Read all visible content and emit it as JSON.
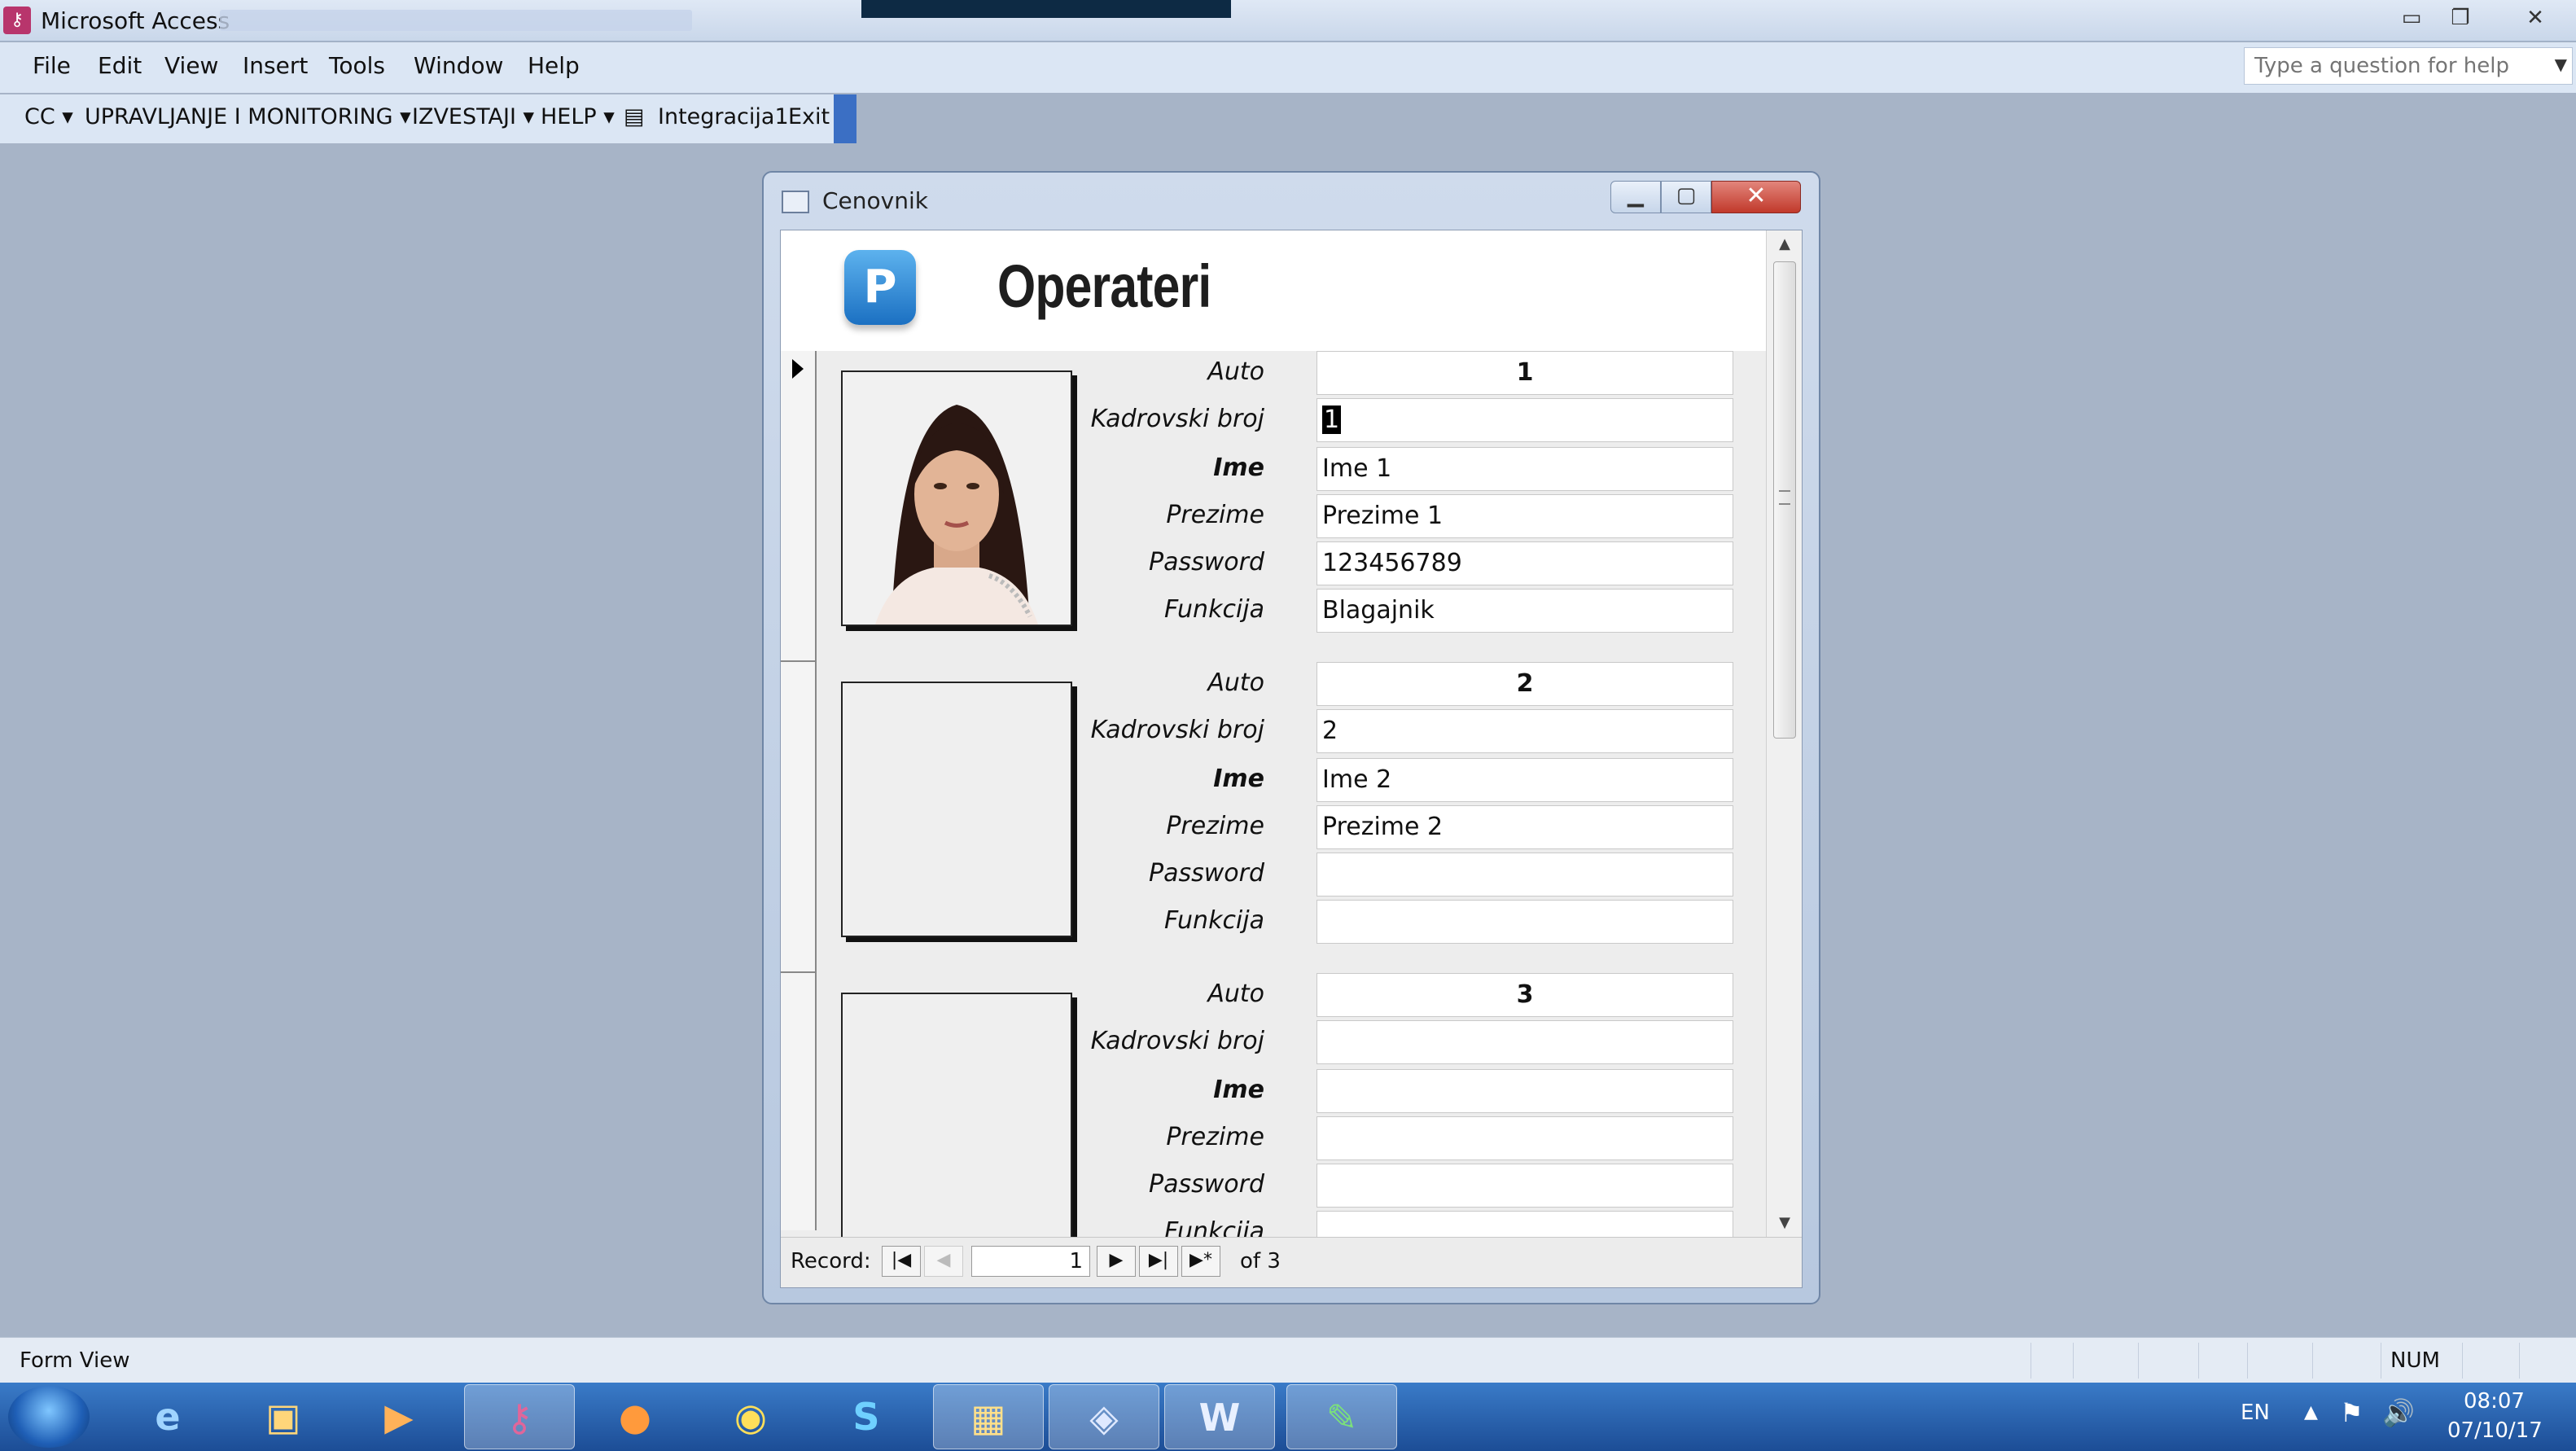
{
  "app": {
    "title": "Microsoft Access"
  },
  "menu": {
    "items": [
      {
        "label": "File"
      },
      {
        "label": "Edit"
      },
      {
        "label": "View"
      },
      {
        "label": "Insert"
      },
      {
        "label": "Tools"
      },
      {
        "label": "Window"
      },
      {
        "label": "Help"
      }
    ],
    "help_placeholder": "Type a question for help"
  },
  "toolbar": {
    "cc": "CC",
    "upravljanje": "UPRAVLJANJE I MONITORING",
    "izvestaji": "IZVESTAJI",
    "help": "HELP",
    "integracija": "Integracija1",
    "exit": "Exit"
  },
  "form": {
    "window_title": "Cenovnik",
    "header_title": "Operateri",
    "logo_letter": "P",
    "labels": {
      "auto": "Auto",
      "kadrovski": "Kadrovski broj",
      "ime": "Ime",
      "prezime": "Prezime",
      "password": "Password",
      "funkcija": "Funkcija"
    },
    "records": [
      {
        "auto": "1",
        "kadrovski": "1",
        "ime": "Ime 1",
        "prezime": "Prezime 1",
        "password": "123456789",
        "funkcija": "Blagajnik"
      },
      {
        "auto": "2",
        "kadrovski": "2",
        "ime": "Ime 2",
        "prezime": "Prezime 2",
        "password": "",
        "funkcija": ""
      },
      {
        "auto": "3",
        "kadrovski": "",
        "ime": "",
        "prezime": "",
        "password": "",
        "funkcija": ""
      }
    ]
  },
  "navigation": {
    "label": "Record:",
    "current": "1",
    "of_text": "of",
    "total": "3"
  },
  "status": {
    "text": "Form View",
    "num": "NUM"
  },
  "tray": {
    "language": "EN",
    "time": "08:07",
    "date": "07/10/17"
  },
  "icons": {
    "app": "access-icon",
    "logo": "p-logo-icon",
    "current_record": "record-pointer-icon"
  },
  "colors": {
    "desktop_bg": "#a7b4c7",
    "close_button": "#c1392b",
    "taskbar": "#1c4d96"
  }
}
